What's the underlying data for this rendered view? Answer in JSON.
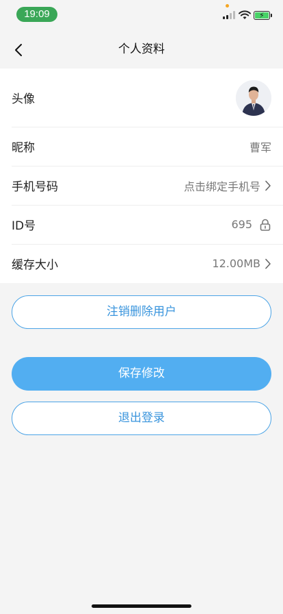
{
  "status": {
    "time": "19:09",
    "time_pill_color": "#3aa757",
    "battery_color": "#48d267"
  },
  "nav": {
    "title": "个人资料",
    "back_icon": "chevron-left-icon"
  },
  "rows": {
    "avatar": {
      "label": "头像"
    },
    "nickname": {
      "label": "昵称",
      "value": "曹军"
    },
    "phone": {
      "label": "手机号码",
      "value": "点击绑定手机号"
    },
    "id": {
      "label": "ID号",
      "value": "695"
    },
    "cache": {
      "label": "缓存大小",
      "value": "12.00MB"
    }
  },
  "buttons": {
    "delete_user": "注销删除用户",
    "save": "保存修改",
    "logout": "退出登录"
  },
  "colors": {
    "accent": "#52aef1",
    "outline": "#4aa3e6",
    "background": "#f4f4f4"
  }
}
